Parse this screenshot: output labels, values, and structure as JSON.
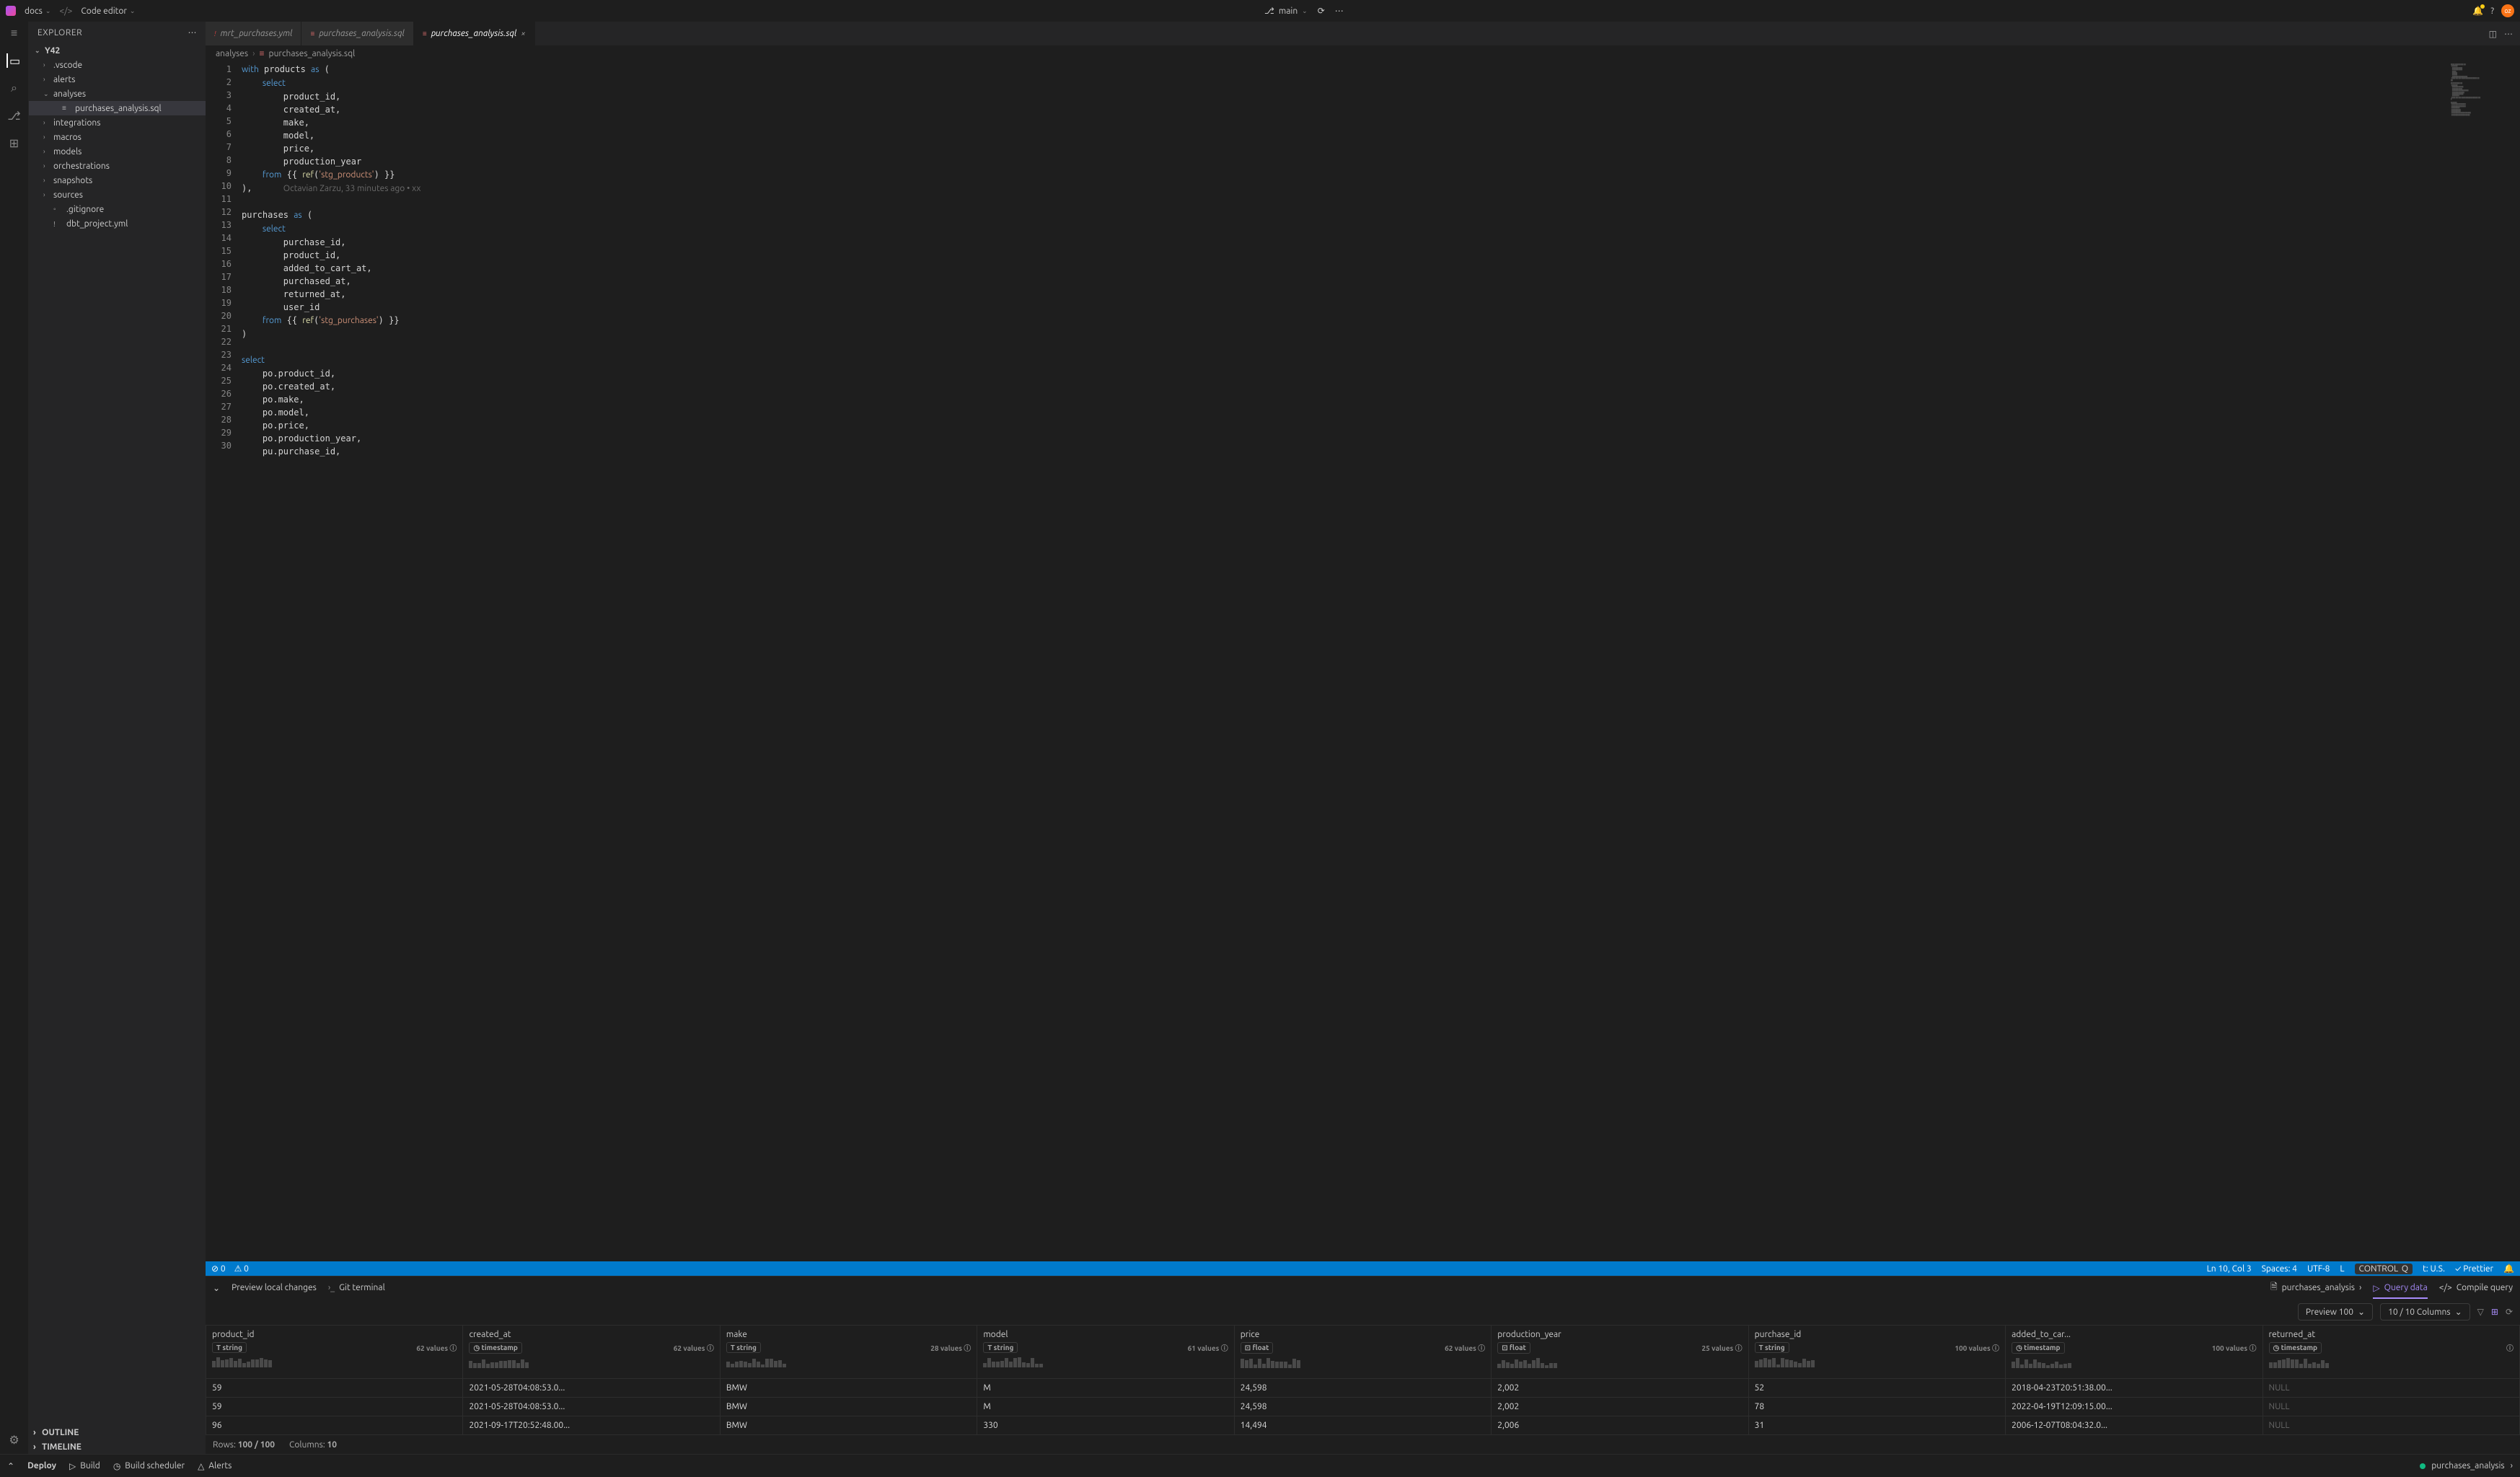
{
  "topbar": {
    "docs": "docs",
    "code_editor": "Code editor",
    "branch": "main",
    "avatar": "oz"
  },
  "explorer": {
    "title": "EXPLORER",
    "root": "Y42",
    "items": [
      {
        "label": ".vscode",
        "depth": 1,
        "chev": "›"
      },
      {
        "label": "alerts",
        "depth": 1,
        "chev": "›"
      },
      {
        "label": "analyses",
        "depth": 1,
        "chev": "⌄"
      },
      {
        "label": "purchases_analysis.sql",
        "depth": 2,
        "chev": "",
        "sel": true,
        "icon": "≡"
      },
      {
        "label": "integrations",
        "depth": 1,
        "chev": "›"
      },
      {
        "label": "macros",
        "depth": 1,
        "chev": "›"
      },
      {
        "label": "models",
        "depth": 1,
        "chev": "›"
      },
      {
        "label": "orchestrations",
        "depth": 1,
        "chev": "›"
      },
      {
        "label": "snapshots",
        "depth": 1,
        "chev": "›"
      },
      {
        "label": "sources",
        "depth": 1,
        "chev": "›"
      },
      {
        "label": ".gitignore",
        "depth": 1,
        "chev": "",
        "icon": "◦"
      },
      {
        "label": "dbt_project.yml",
        "depth": 1,
        "chev": "",
        "icon": "!"
      }
    ],
    "outline": "OUTLINE",
    "timeline": "TIMELINE"
  },
  "tabs": [
    {
      "label": "mrt_purchases.yml",
      "icon": "!",
      "color": "#d04040"
    },
    {
      "label": "purchases_analysis.sql",
      "icon": "≡",
      "color": "#d16969"
    },
    {
      "label": "purchases_analysis.sql",
      "icon": "≡",
      "color": "#d16969",
      "active": true
    }
  ],
  "breadcrumb": {
    "a": "analyses",
    "b": "purchases_analysis.sql"
  },
  "code": {
    "lines": [
      "with products as (",
      "    select",
      "        product_id,",
      "        created_at,",
      "        make,",
      "        model,",
      "        price,",
      "        production_year",
      "    from {{ ref('stg_products') }}",
      "),      Octavian Zarzu, 33 minutes ago • xx",
      "",
      "purchases as (",
      "    select",
      "        purchase_id,",
      "        product_id,",
      "        added_to_cart_at,",
      "        purchased_at,",
      "        returned_at,",
      "        user_id",
      "    from {{ ref('stg_purchases') }}",
      ")",
      "",
      "select",
      "    po.product_id,",
      "    po.created_at,",
      "    po.make,",
      "    po.model,",
      "    po.price,",
      "    po.production_year,",
      "    pu.purchase_id,"
    ]
  },
  "statusbar": {
    "errors": "0",
    "warnings": "0",
    "cursor": "Ln 10, Col 3",
    "spaces": "Spaces: 4",
    "enc": "UTF-8",
    "lf": "L",
    "layout": "t: U.S.",
    "ctrl": "CONTROL",
    "q": "Q",
    "prettier": "Prettier"
  },
  "preview": {
    "tab_local": "Preview local changes",
    "tab_git": "Git terminal",
    "file": "purchases_analysis",
    "query": "Query data",
    "compile": "Compile query",
    "preview100": "Preview 100",
    "cols": "10 / 10 Columns",
    "rows_label": "Rows:",
    "rows_val": "100 / 100",
    "cols_label": "Columns:",
    "cols_val": "10"
  },
  "columns": [
    {
      "name": "product_id",
      "type": "string",
      "vals": "62 values"
    },
    {
      "name": "created_at",
      "type": "timestamp",
      "vals": "62 values"
    },
    {
      "name": "make",
      "type": "string",
      "vals": "28 values"
    },
    {
      "name": "model",
      "type": "string",
      "vals": "61 values"
    },
    {
      "name": "price",
      "type": "float",
      "vals": "62 values"
    },
    {
      "name": "production_year",
      "type": "float",
      "vals": "25 values"
    },
    {
      "name": "purchase_id",
      "type": "string",
      "vals": "100 values"
    },
    {
      "name": "added_to_car...",
      "type": "timestamp",
      "vals": "100 values"
    },
    {
      "name": "returned_at",
      "type": "timestamp",
      "vals": ""
    }
  ],
  "rows": [
    [
      "59",
      "2021-05-28T04:08:53.0...",
      "BMW",
      "M",
      "24,598",
      "2,002",
      "52",
      "2018-04-23T20:51:38.00...",
      "NULL"
    ],
    [
      "59",
      "2021-05-28T04:08:53.0...",
      "BMW",
      "M",
      "24,598",
      "2,002",
      "78",
      "2022-04-19T12:09:15.00...",
      "NULL"
    ],
    [
      "96",
      "2021-09-17T20:52:48.00...",
      "BMW",
      "330",
      "14,494",
      "2,006",
      "31",
      "2006-12-07T08:04:32.0...",
      "NULL"
    ]
  ],
  "bottombar": {
    "deploy": "Deploy",
    "build": "Build",
    "scheduler": "Build scheduler",
    "alerts": "Alerts",
    "file": "purchases_analysis"
  }
}
